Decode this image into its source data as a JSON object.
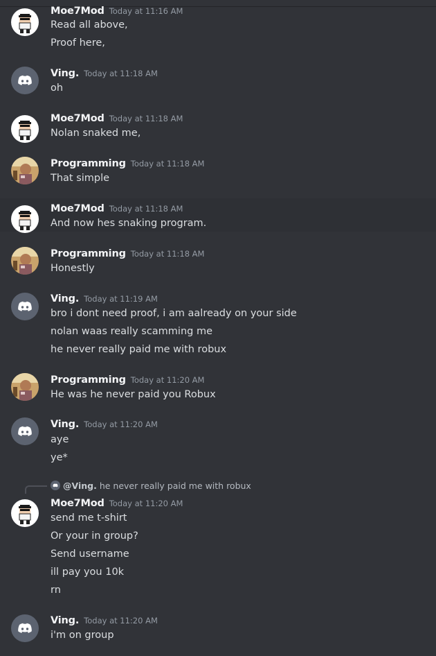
{
  "colors": {
    "background": "#313338",
    "highlight": "#2e3035",
    "discord_blurple": "#5865f2",
    "discord_gray_avatar": "#5c6370"
  },
  "users": {
    "moe": {
      "name": "Moe7Mod",
      "avatar_icon": "pixel-character-avatar"
    },
    "ving": {
      "name": "Ving.",
      "avatar_icon": "discord-logo-avatar"
    },
    "prog": {
      "name": "Programming",
      "avatar_icon": "photo-avatar"
    }
  },
  "messages": [
    {
      "author": "Moe7Mod",
      "timestamp": "Today at 11:16 AM",
      "lines": [
        "Read all above,",
        "Proof here,"
      ]
    },
    {
      "author": "Ving.",
      "timestamp": "Today at 11:18 AM",
      "lines": [
        "oh"
      ]
    },
    {
      "author": "Moe7Mod",
      "timestamp": "Today at 11:18 AM",
      "lines": [
        "Nolan snaked me,"
      ]
    },
    {
      "author": "Programming",
      "timestamp": "Today at 11:18 AM",
      "lines": [
        "That simple"
      ]
    },
    {
      "author": "Moe7Mod",
      "timestamp": "Today at 11:18 AM",
      "lines": [
        "And now hes snaking program."
      ]
    },
    {
      "author": "Programming",
      "timestamp": "Today at 11:18 AM",
      "lines": [
        "Honestly"
      ]
    },
    {
      "author": "Ving.",
      "timestamp": "Today at 11:19 AM",
      "lines": [
        "bro i dont need proof, i am aalready on your side",
        "nolan waas really scamming me",
        "he never really paid me with robux"
      ]
    },
    {
      "author": "Programming",
      "timestamp": "Today at 11:20 AM",
      "lines": [
        "He was he never paid you Robux"
      ]
    },
    {
      "author": "Ving.",
      "timestamp": "Today at 11:20 AM",
      "lines": [
        "aye",
        "ye*"
      ]
    },
    {
      "author": "Moe7Mod",
      "timestamp": "Today at 11:20 AM",
      "reply": {
        "mention": "@Ving.",
        "text": "he never really paid me with robux"
      },
      "lines": [
        "send me t-shirt",
        "Or your in group?",
        "Send username",
        "ill pay you 10k",
        "rn"
      ]
    },
    {
      "author": "Ving.",
      "timestamp": "Today at 11:20 AM",
      "lines": [
        "i'm on group"
      ]
    }
  ]
}
